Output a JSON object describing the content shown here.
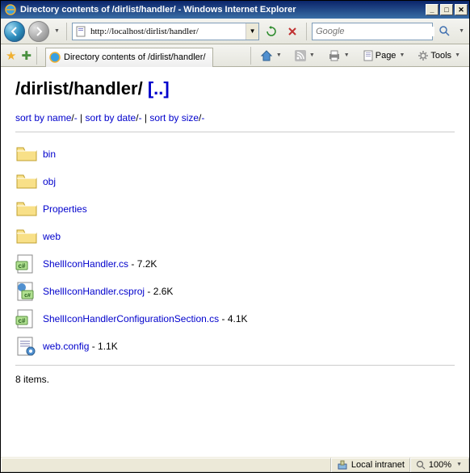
{
  "window": {
    "title": "Directory contents of /dirlist/handler/ - Windows Internet Explorer"
  },
  "address": {
    "url": "http://localhost/dirlist/handler/"
  },
  "search": {
    "placeholder": "Google"
  },
  "tab": {
    "title": "Directory contents of /dirlist/handler/"
  },
  "toolbar": {
    "page_label": "Page",
    "tools_label": "Tools"
  },
  "page": {
    "path": "/dirlist/handler/",
    "uplink_label": "[..]",
    "sort": {
      "by_name": "sort by name",
      "by_date": "sort by date",
      "by_size": "sort by size",
      "sep": "/",
      "desc": "-",
      "pipe": " | "
    },
    "entries": [
      {
        "icon": "folder",
        "name": "bin",
        "size": ""
      },
      {
        "icon": "folder",
        "name": "obj",
        "size": ""
      },
      {
        "icon": "folder",
        "name": "Properties",
        "size": ""
      },
      {
        "icon": "folder",
        "name": "web",
        "size": ""
      },
      {
        "icon": "cs",
        "name": "ShellIconHandler.cs",
        "size": "7.2K"
      },
      {
        "icon": "csproj",
        "name": "ShellIconHandler.csproj",
        "size": "2.6K"
      },
      {
        "icon": "cs",
        "name": "ShellIconHandlerConfigurationSection.cs",
        "size": "4.1K"
      },
      {
        "icon": "config",
        "name": "web.config",
        "size": "1.1K"
      }
    ],
    "count_label": "8 items."
  },
  "status": {
    "zone": "Local intranet",
    "zoom": "100%"
  }
}
